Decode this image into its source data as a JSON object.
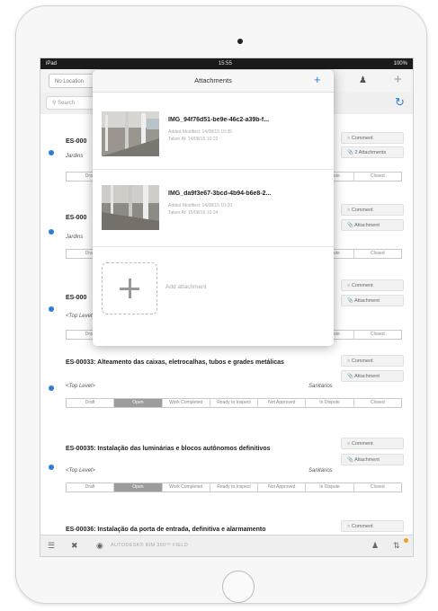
{
  "status_bar": {
    "carrier": "iPad",
    "time": "15:55",
    "battery": "100%"
  },
  "navbar": {
    "location_button": "No Location"
  },
  "search": {
    "placeholder": "Search"
  },
  "popover": {
    "title": "Attachments",
    "attachments": [
      {
        "name": "IMG_94f76d51-be9e-46c2-a39b-f...",
        "added": "Added Modified: 14/08/15 10:35",
        "taken": "Taken At: 14/08/15 10:22"
      },
      {
        "name": "IMG_da9f3e67-3bcd-4b94-b6e8-2...",
        "added": "Added Modified: 14/08/15 10:20",
        "taken": "Taken At: 15/08/15 10:24"
      }
    ],
    "add_label": "Add attachment"
  },
  "statuses": [
    "Draft",
    "Open",
    "Work Completed",
    "Ready to Inspect",
    "Not Approved",
    "In Dispute",
    "Closed"
  ],
  "issues": [
    {
      "title": "ES-000",
      "location": "Jardins",
      "assignee": "",
      "comment": "Comment",
      "attach": "2 Attachments"
    },
    {
      "title": "ES-000",
      "location": "Jardins",
      "assignee": "",
      "comment": "Comment",
      "attach": "Attachment"
    },
    {
      "title": "ES-000",
      "location": "<Top Level>",
      "assignee": "",
      "comment": "Comment",
      "attach": "Attachment"
    },
    {
      "title": "ES-00033: Alteamento das caixas, eletrocalhas, tubos e grades metálicas",
      "location": "<Top Level>",
      "assignee": "Sanitários",
      "comment": "Comment",
      "attach": "Attachment"
    },
    {
      "title": "ES-00035: Instalação das luminárias e blocos autônomos definitivos",
      "location": "<Top Level>",
      "assignee": "Sanitários",
      "comment": "Comment",
      "attach": "Attachment"
    },
    {
      "title": "ES-00036: Instalação da porta de entrada, definitiva e alarmamento",
      "location": "",
      "assignee": "",
      "comment": "Comment",
      "attach": ""
    }
  ],
  "bottom_bar": {
    "brand": "AUTODESK® BIM 360™ FIELD"
  },
  "colors": {
    "accent": "#2a7fd9",
    "badge": "#f0a020",
    "status_active": "#9c9c9c"
  }
}
